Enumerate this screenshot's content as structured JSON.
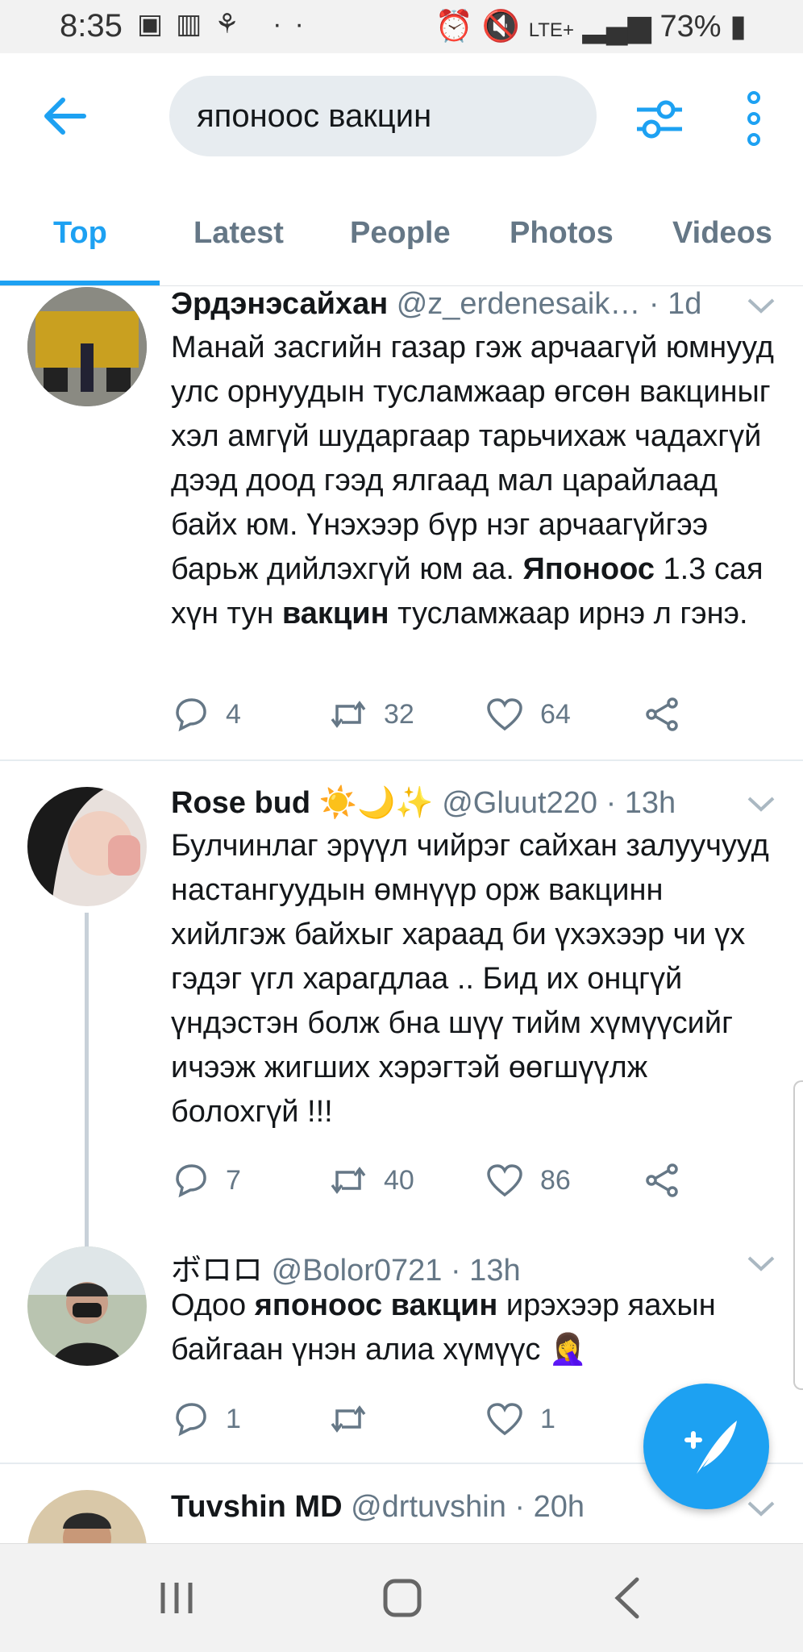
{
  "status_bar": {
    "time": "8:35",
    "battery": "73%",
    "network": "LTE+"
  },
  "search": {
    "query": "японоос вакцин"
  },
  "tabs": [
    "Top",
    "Latest",
    "People",
    "Photos",
    "Videos"
  ],
  "active_tab": "Top",
  "tweets": [
    {
      "name": "Эрдэнэсайхан",
      "handle": "@z_erdenesaik…",
      "time": "· 1d",
      "text_parts": [
        "Манай засгийн газар гэж арчаагүй юмнууд улс орнуудын тусламжаар өгсөн вакциныг хэл амгүй шударгаар тарьчихаж чадахгүй дээд доод гээд ялгаад мал царайлаад байх юм. Үнэхээр бүр нэг арчаагүйгээ барьж дийлэхгүй юм аа. ",
        "Японоос",
        " 1.3 сая хүн тун ",
        "вакцин",
        " тусламжаар ирнэ л гэнэ."
      ],
      "replies": "4",
      "retweets": "32",
      "likes": "64"
    },
    {
      "name": "Rose bud ☀️🌙✨",
      "handle": "@Gluut220",
      "time": "· 13h",
      "text": "Булчинлаг эрүүл чийрэг сайхан залуучууд настангуудын өмнүүр орж вакцинн хийлгэж байхыг хараад би үхэхээр чи үх гэдэг үгл харагдлаа .. Бид их онцгүй үндэстэн болж бна шүү тийм хүмүүсийг ичээж жигших хэрэгтэй өөгшүүлж болохгүй !!!",
      "replies": "7",
      "retweets": "40",
      "likes": "86"
    },
    {
      "name": "ボロロ",
      "handle": "@Bolor0721",
      "time": "· 13h",
      "text_parts": [
        "Одоо ",
        "японоос вакцин",
        " ирэхээр яахын байгаан үнэн алиа хүмүүс 🤦‍♀️"
      ],
      "replies": "1",
      "retweets": "",
      "likes": "1"
    },
    {
      "name": "Tuvshin MD",
      "handle": "@drtuvshin",
      "time": "· 20h"
    }
  ],
  "colors": {
    "accent": "#1da1f2",
    "secondary_text": "#657786",
    "search_bg": "#e7ecf0"
  }
}
